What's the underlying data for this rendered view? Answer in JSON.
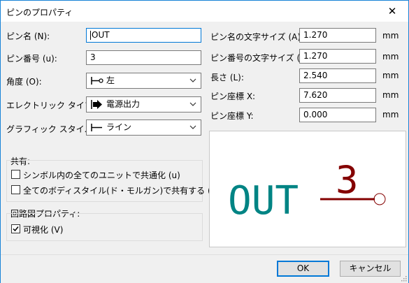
{
  "window": {
    "title": "ピンのプロパティ",
    "close_glyph": "✕"
  },
  "left": {
    "pin_name_label": "ピン名 (N):",
    "pin_name_value": "OUT",
    "pin_number_label": "ピン番号 (u):",
    "pin_number_value": "3",
    "orientation_label": "角度 (O):",
    "orientation_value": "左",
    "orientation_icon": "pin-left-icon",
    "electrical_type_label": "エレクトリック タイプ (E):",
    "electrical_type_value": "電源出力",
    "electrical_type_icon": "power-output-arrow-icon",
    "graphic_style_label": "グラフィック スタイル (S):",
    "graphic_style_value": "ライン",
    "graphic_style_icon": "line-style-icon"
  },
  "shared": {
    "heading": "共有:",
    "all_units_label": "シンボル内の全てのユニットで共通化 (u)",
    "all_units_checked": false,
    "all_styles_label": "全てのボディスタイル(ド・モルガン)で共有する (S)",
    "all_styles_checked": false
  },
  "schematic": {
    "heading": "回路図プロパティ:",
    "visible_label": "可視化 (V)",
    "visible_checked": true
  },
  "right": {
    "name_text_size_label": "ピン名の文字サイズ (A):",
    "name_text_size_value": "1.270",
    "number_text_size_label": "ピン番号の文字サイズ (X):",
    "number_text_size_value": "1.270",
    "length_label": "長さ (L):",
    "length_value": "2.540",
    "pos_x_label": "ピン座標 X:",
    "pos_x_value": "7.620",
    "pos_y_label": "ピン座標 Y:",
    "pos_y_value": "0.000",
    "unit": "mm"
  },
  "preview": {
    "pin_name": "OUT",
    "pin_number": "3",
    "name_color": "#008484",
    "pin_color": "#840000"
  },
  "buttons": {
    "ok": "OK",
    "cancel": "キャンセル"
  },
  "colors": {
    "accent": "#0078d7",
    "window_border": "#1883d7"
  }
}
